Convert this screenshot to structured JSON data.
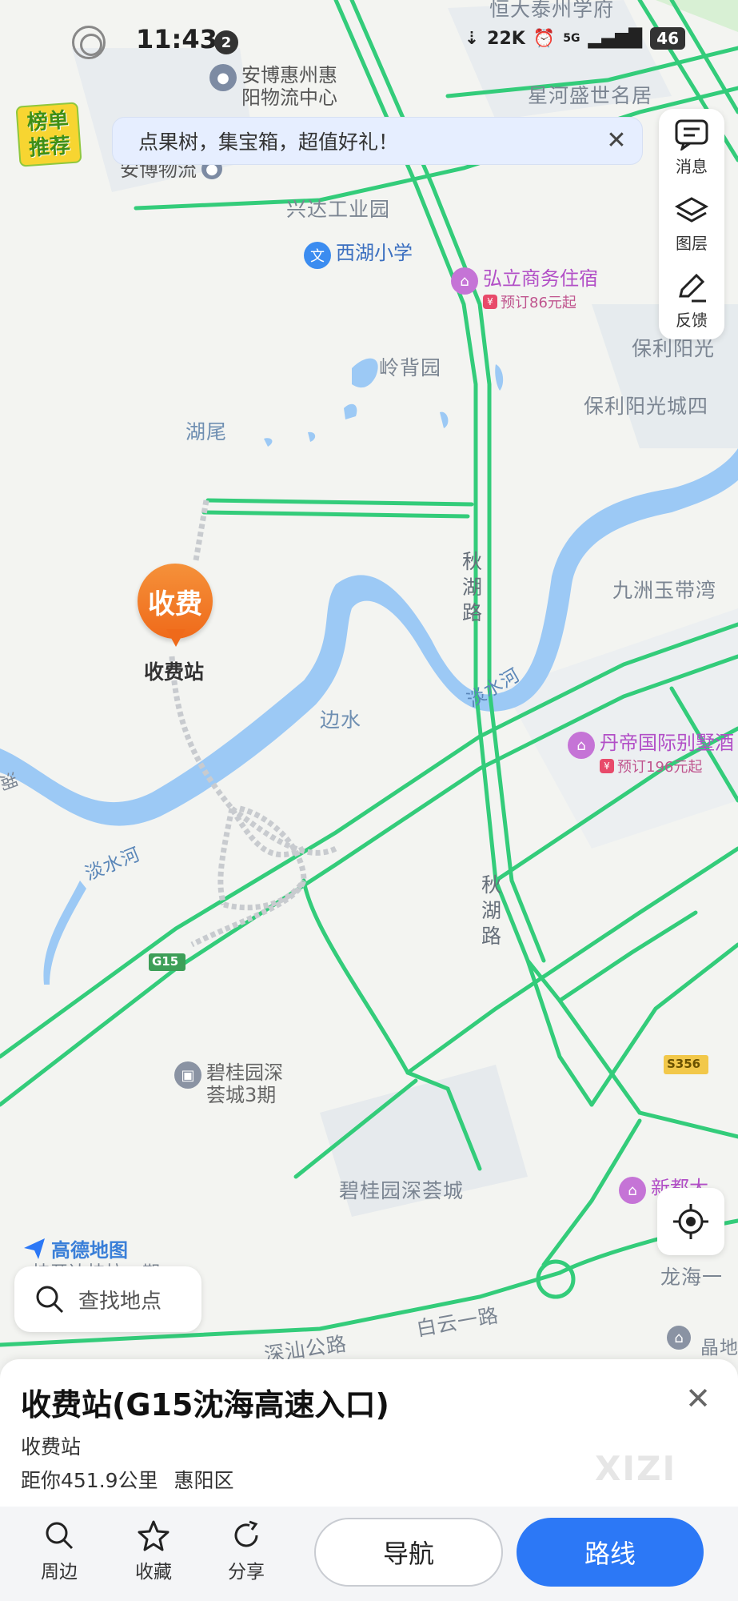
{
  "status": {
    "time": "11:43",
    "notif_count": "2",
    "net_speed": "22K",
    "signal": "5G",
    "battery": "46"
  },
  "badge": {
    "label_line1": "榜单",
    "label_line2": "推荐"
  },
  "promo": {
    "text": "点果树，集宝箱，超值好礼！",
    "close": "✕"
  },
  "tools": {
    "messages": "消息",
    "layers": "图层",
    "feedback": "反馈"
  },
  "map": {
    "labels": {
      "top_block": "恒大泰州学府",
      "xinghe": "星河盛世名居",
      "xingda": "兴达工业园",
      "lingbei": "岭背园",
      "baoli1": "保利阳光",
      "baoli2": "保利阳光城四",
      "huwei": "湖尾",
      "jiuzhou": "九洲玉带湾",
      "bianshui": "边水",
      "river1": "淡水河",
      "river2": "淡水河",
      "road_qiuhu1": "秋湖路",
      "road_qiuhu2": "秋湖路",
      "biguiyuan": "碧桂园深荟城",
      "longhai": "龙海一",
      "baiyun": "白云一路",
      "shensha": "深汕公路",
      "hexian": "湖",
      "jingdi": "晶地",
      "left_partial": "枝开达枝拉一期",
      "g15": "G15",
      "s356": "S356"
    },
    "pois": {
      "anbo_huizhou": {
        "line1": "安博惠州惠",
        "line2": "阳物流中心"
      },
      "anbo": "安博物流",
      "xihu_school": "西湖小学",
      "hongli": {
        "name": "弘立商务住宿",
        "price": "预订86元起"
      },
      "dandi": {
        "name": "丹帝国际别墅酒",
        "price": "预订196元起"
      },
      "biguiyuan3": {
        "line1": "碧桂园深",
        "line2": "荟城3期"
      },
      "xindu": "新都大"
    },
    "toll_marker": "收费",
    "toll_label": "收费站",
    "amap_logo": "高德地图"
  },
  "search": {
    "placeholder": "查找地点"
  },
  "sheet": {
    "title": "收费站(G15沈海高速入口)",
    "category": "收费站",
    "distance": "距你451.9公里",
    "district": "惠阳区",
    "watermark": "XIZI",
    "close": "✕"
  },
  "actions": {
    "nearby": "周边",
    "favorite": "收藏",
    "share": "分享",
    "navigate": "导航",
    "route": "路线"
  },
  "colors": {
    "road": "#33cc7a",
    "water": "#9cc9f5",
    "accent": "#2c78f6",
    "toll": "#ef6a1a"
  }
}
